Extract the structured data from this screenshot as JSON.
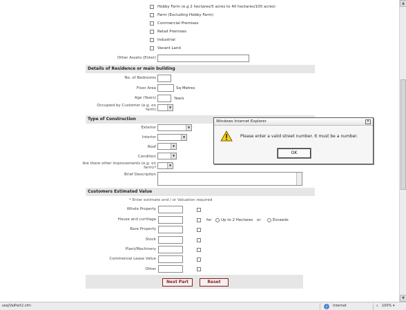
{
  "property_types": [
    "Hobby Farm (e.g 2 hectares/5 acres to 40 hectares/100 acres)",
    "Farm (Excluding Hobby Farm)",
    "Commercial Premises",
    "Retail Premises",
    "Industrial",
    "Vacant Land"
  ],
  "other_assets_label": "Other Assets (Enter)",
  "residence": {
    "heading": "Details of Residence or main building",
    "bedrooms_label": "No. of Bedrooms",
    "floor_area_label": "Floor Area",
    "floor_area_unit": "Sq Metres",
    "age_label": "Age (Years)",
    "age_unit": "Years",
    "occupied_label": "Occupied by Customer (e.g. on farm)"
  },
  "construction": {
    "heading": "Type of Construction",
    "exterior_label": "Exterior",
    "interior_label": "Interior",
    "roof_label": "Roof",
    "condition_label": "Condition",
    "other_label": "Are there other improvements (e.g. on farm)?",
    "brief_label": "Brief Description"
  },
  "estimated_value": {
    "heading": "Customers Estimated Value",
    "note": "* Enter estimate and / or Valuation required",
    "rows": [
      "Whole Property",
      "House and curtilage",
      "Bare Property",
      "Stock",
      "Plant/Machinery",
      "Commercial Lease Value",
      "Other"
    ],
    "for_label": "for",
    "radio_up_to": "Up to 2 Hectares",
    "or_label": "or",
    "radio_exceeds": "Exceeds"
  },
  "buttons": {
    "next": "Next Part",
    "reset": "Reset"
  },
  "dialog": {
    "title": "Windows Internet Explorer",
    "close": "x",
    "message": "Please enter a valid street number. It must be a number.",
    "ok": "OK"
  },
  "status": {
    "url": "seq/ValPart2.cfm",
    "zone": "Internet",
    "zoom": "100%"
  }
}
